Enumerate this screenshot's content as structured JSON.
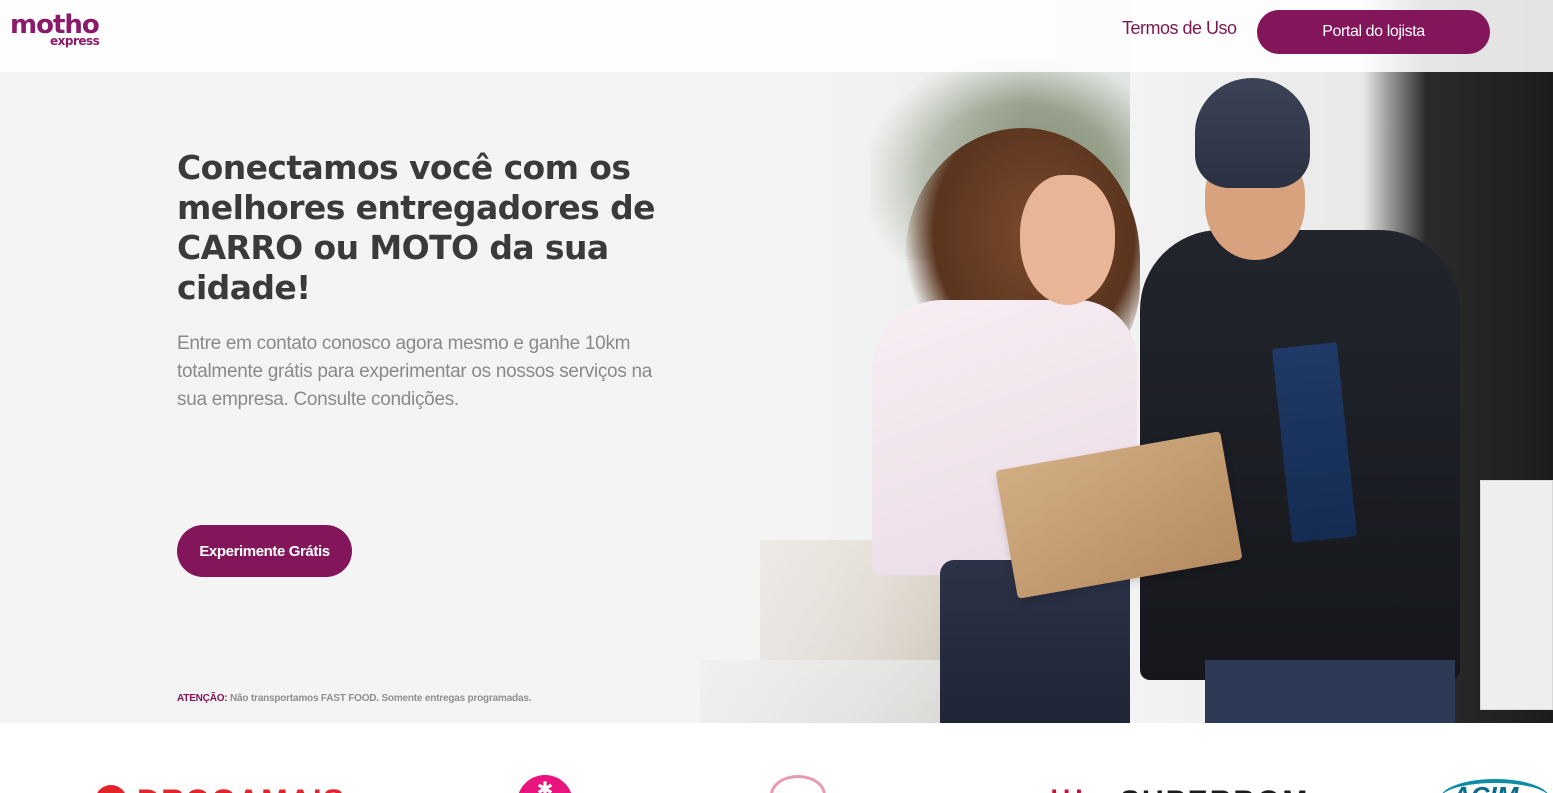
{
  "brand": {
    "logo_main": "motho",
    "logo_sub": "express",
    "accent_color": "#83155b"
  },
  "nav": {
    "terms_label": "Termos de Uso",
    "portal_label": "Portal do lojista"
  },
  "hero": {
    "title": "Conectamos você com os melhores entregadores de CARRO ou MOTO da sua cidade!",
    "description": "Entre em contato conosco agora mesmo e ganhe 10km totalmente grátis para experimentar os nossos serviços na sua empresa. Consulte condições.",
    "cta_label": "Experimente Grátis",
    "warning_label": "ATENÇÃO:",
    "warning_text": " Não transportamos FAST FOOD. Somente entregas programadas."
  },
  "partners": {
    "items": [
      {
        "icon": "drogamais-logo",
        "color": "#e3242b"
      },
      {
        "icon": "pink-circle-logo",
        "color": "#e9147e"
      },
      {
        "icon": "bunny-logo",
        "color": "#e79ab0"
      },
      {
        "icon": "superbom-logo",
        "color": "#c8102e"
      },
      {
        "icon": "acim-logo",
        "color": "#0b8ca4"
      }
    ]
  }
}
